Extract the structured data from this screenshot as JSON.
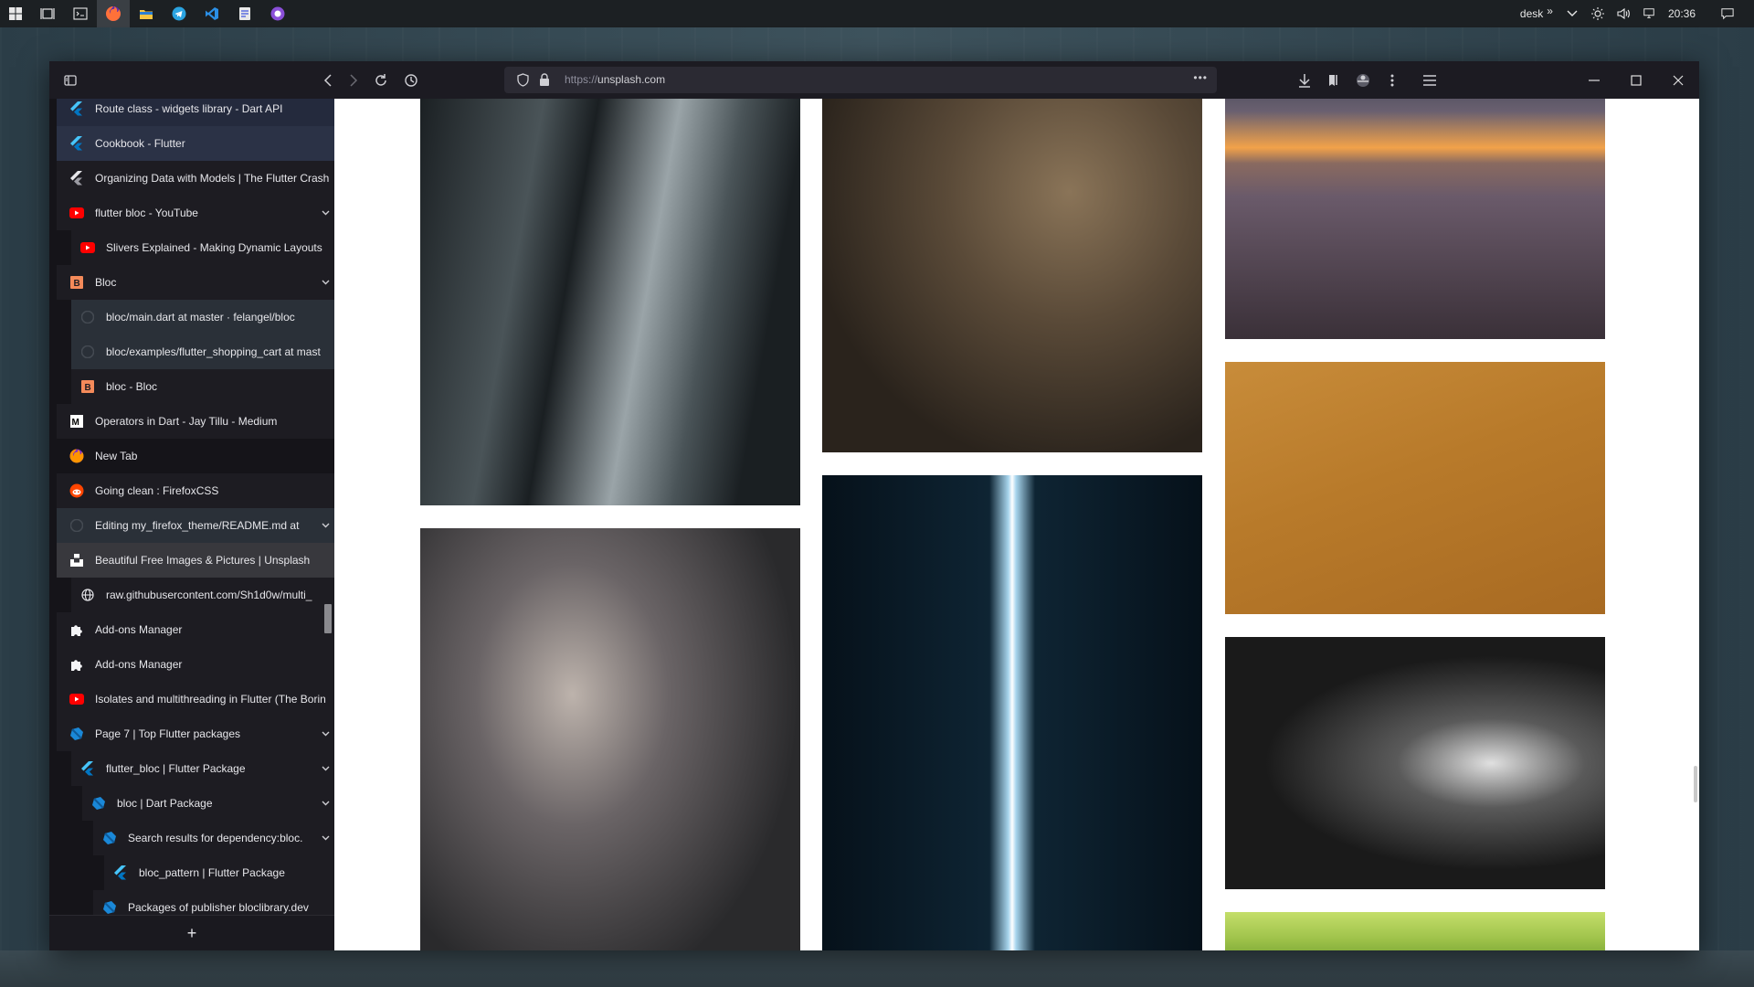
{
  "taskbar": {
    "desk_label": "desk",
    "overflow_label": "»",
    "time": "20:36",
    "apps": [
      {
        "icon": "windows-start-icon",
        "color": "#e8e8e8"
      },
      {
        "icon": "task-view-icon",
        "color": "#e8e8e8"
      },
      {
        "icon": "terminal-icon",
        "color": "#e8e8e8"
      },
      {
        "icon": "firefox-icon",
        "color": "#ff7139"
      },
      {
        "icon": "file-explorer-icon",
        "color": "#f5c542"
      },
      {
        "icon": "telegram-icon",
        "color": "#2aa3e0"
      },
      {
        "icon": "vscode-icon",
        "color": "#2b8fe5"
      },
      {
        "icon": "notes-app-icon",
        "color": "#5b6ee1"
      },
      {
        "icon": "purple-app-icon",
        "color": "#8a4fd8"
      }
    ]
  },
  "browser": {
    "url_prefix": "https://",
    "url_domain": "unsplash.com",
    "menu_dots": "•••"
  },
  "sidebar": {
    "new_tab_label": "+",
    "tabs": [
      {
        "label": "Route class - widgets library - Dart API",
        "icon": "flutter-icon",
        "indent": 0,
        "chevron": false,
        "bg": "#242a3d"
      },
      {
        "label": "Cookbook - Flutter",
        "icon": "flutter-icon",
        "indent": 0,
        "chevron": false,
        "bg": "#2b3246"
      },
      {
        "label": "Organizing Data with Models | The Flutter Crash",
        "icon": "flutter-dark-icon",
        "indent": 0,
        "chevron": false,
        "bg": "#1d1c22"
      },
      {
        "label": "flutter bloc - YouTube",
        "icon": "youtube-icon",
        "indent": 0,
        "chevron": true,
        "bg": "#1d1c22"
      },
      {
        "label": "Slivers Explained - Making Dynamic Layouts",
        "icon": "youtube-icon",
        "indent": 1,
        "chevron": false,
        "bg": "#1d1c22"
      },
      {
        "label": "Bloc",
        "icon": "bloc-icon",
        "indent": 0,
        "chevron": true,
        "bg": "#1d1c22"
      },
      {
        "label": "bloc/main.dart at master · felangel/bloc",
        "icon": "github-icon",
        "indent": 1,
        "chevron": false,
        "bg": "#2a3038"
      },
      {
        "label": "bloc/examples/flutter_shopping_cart at mast",
        "icon": "github-icon",
        "indent": 1,
        "chevron": false,
        "bg": "#2a3038"
      },
      {
        "label": "bloc - Bloc",
        "icon": "bloc-icon",
        "indent": 1,
        "chevron": false,
        "bg": "#1d1c22"
      },
      {
        "label": "Operators in Dart - Jay Tillu - Medium",
        "icon": "medium-icon",
        "indent": 0,
        "chevron": false,
        "bg": "#1d1c22"
      },
      {
        "label": "New Tab",
        "icon": "firefox-icon",
        "indent": 0,
        "chevron": false,
        "bg": "#151419"
      },
      {
        "label": "Going clean : FirefoxCSS",
        "icon": "reddit-icon",
        "indent": 0,
        "chevron": false,
        "bg": "#1d1c22"
      },
      {
        "label": "Editing my_firefox_theme/README.md at",
        "icon": "github-icon",
        "indent": 0,
        "chevron": true,
        "bg": "#2a3038"
      },
      {
        "label": "Beautiful Free Images & Pictures | Unsplash",
        "icon": "unsplash-icon",
        "indent": 0,
        "chevron": false,
        "bg": "#38383d"
      },
      {
        "label": "raw.githubusercontent.com/Sh1d0w/multi_",
        "icon": "globe-icon",
        "indent": 1,
        "chevron": false,
        "bg": "#1d1c22"
      },
      {
        "label": "Add-ons Manager",
        "icon": "puzzle-icon",
        "indent": 0,
        "chevron": false,
        "bg": "#1d1c22"
      },
      {
        "label": "Add-ons Manager",
        "icon": "puzzle-icon",
        "indent": 0,
        "chevron": false,
        "bg": "#1d1c22"
      },
      {
        "label": "Isolates and multithreading in Flutter (The Borin",
        "icon": "youtube-icon",
        "indent": 0,
        "chevron": false,
        "bg": "#1d1c22"
      },
      {
        "label": "Page 7 | Top Flutter packages",
        "icon": "dart-icon",
        "indent": 0,
        "chevron": true,
        "bg": "#1d1c22"
      },
      {
        "label": "flutter_bloc | Flutter Package",
        "icon": "flutter-icon",
        "indent": 1,
        "chevron": true,
        "bg": "#1d1c22"
      },
      {
        "label": "bloc | Dart Package",
        "icon": "dart-icon",
        "indent": 2,
        "chevron": true,
        "bg": "#1d1c22"
      },
      {
        "label": "Search results for dependency:bloc.",
        "icon": "dart-icon",
        "indent": 3,
        "chevron": true,
        "bg": "#1d1c22"
      },
      {
        "label": "bloc_pattern | Flutter Package",
        "icon": "flutter-icon",
        "indent": 4,
        "chevron": false,
        "bg": "#1d1c22"
      },
      {
        "label": "Packages of publisher bloclibrary.dev",
        "icon": "dart-icon",
        "indent": 3,
        "chevron": false,
        "bg": "#1d1c22"
      }
    ]
  },
  "content": {
    "photos": [
      {
        "name": "photo-city-buildings",
        "colors": [
          "#1a1f22",
          "#4a5458",
          "#9aa4a8"
        ]
      },
      {
        "name": "photo-vintage-camera-hat",
        "colors": [
          "#2a231c",
          "#5a4a38",
          "#8a7458"
        ]
      },
      {
        "name": "photo-sunset-grass",
        "colors": [
          "#f2a24a",
          "#6a5a6a",
          "#3a3038"
        ]
      },
      {
        "name": "photo-flowers-camera",
        "colors": [
          "#2a2a2c",
          "#6a6466",
          "#bdb3ac"
        ]
      },
      {
        "name": "photo-light-beam-person",
        "colors": [
          "#06111a",
          "#0e2433",
          "#a8d6ee"
        ]
      },
      {
        "name": "photo-orange-wall",
        "colors": [
          "#b87a2a",
          "#c88c3a",
          "#a86a22"
        ]
      },
      {
        "name": "photo-bw-sand-dune",
        "colors": [
          "#1a1a1a",
          "#5a5a5a",
          "#e0e0e0"
        ]
      },
      {
        "name": "photo-green-trees",
        "colors": [
          "#9ec24a",
          "#c4de6a",
          "#6a9a2a"
        ]
      }
    ]
  }
}
